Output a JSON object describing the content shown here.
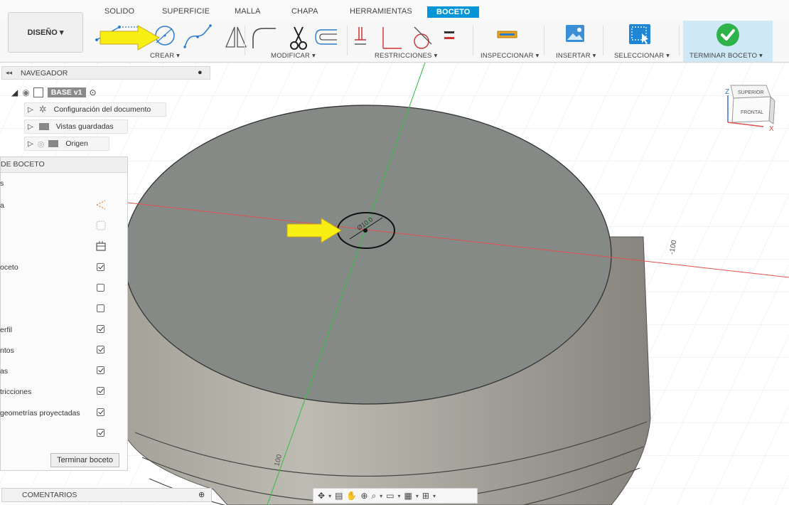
{
  "tabs": [
    "SOLIDO",
    "SUPERFICIE",
    "MALLA",
    "CHAPA",
    "HERRAMIENTAS",
    "BOCETO"
  ],
  "workspace": {
    "label": "DISEÑO ▾"
  },
  "groups": {
    "create": "CREAR ▾",
    "modify": "MODIFICAR ▾",
    "constraints": "RESTRICCIONES ▾",
    "inspect": "INSPECCIONAR ▾",
    "insert": "INSERTAR ▾",
    "select": "SELECCIONAR ▾",
    "finish": "TERMINAR BOCETO ▾"
  },
  "browser": {
    "title": "NAVEGADOR",
    "root": "BASE v1",
    "items": [
      "Configuración del documento",
      "Vistas guardadas",
      "Origen"
    ]
  },
  "palette": {
    "title": "DE BOCETO",
    "rows": [
      "s",
      "a",
      "",
      "",
      "oceto",
      "",
      "",
      "erfil",
      "ntos",
      "as",
      "tricciones",
      " geometrías proyectadas",
      ""
    ],
    "finish_button": "Terminar boceto"
  },
  "comments": {
    "title": "COMENTARIOS"
  },
  "viewcube": {
    "top": "SUPERIOR",
    "front": "FRONTAL",
    "axis_z": "Z",
    "axis_x": "X"
  },
  "viewport_labels": {
    "dim_right": "-100",
    "dim_bottom": "100",
    "circle_dim": "Ø10.0"
  },
  "colors": {
    "accent": "#0696d7",
    "finish_bg": "#cfe8f6",
    "arrow": "#f7ee14",
    "check": "#2eb34b"
  }
}
